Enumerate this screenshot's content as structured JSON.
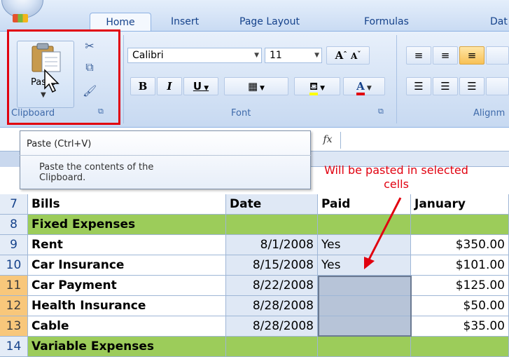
{
  "ribbon": {
    "tabs": [
      "Home",
      "Insert",
      "Page Layout",
      "Formulas",
      "Dat"
    ],
    "clipboard": {
      "paste_label": "Paste",
      "group_label": "Clipboard"
    },
    "font": {
      "name": "Calibri",
      "size": "11",
      "grow_label": "A",
      "shrink_label": "A",
      "bold": "B",
      "italic": "I",
      "underline": "U",
      "color_letter": "A",
      "group_label": "Font"
    },
    "alignment": {
      "group_label": "Alignm"
    }
  },
  "formula_bar": {
    "fx_label": "fx"
  },
  "tooltip": {
    "title": "Paste (Ctrl+V)",
    "body": "Paste the contents of the\nClipboard."
  },
  "annotation": {
    "text": "Will be pasted in selected\ncells"
  },
  "sheet": {
    "rows": [
      {
        "num": "7",
        "bills": "Bills",
        "date": "Date",
        "paid": "Paid",
        "january": "January"
      },
      {
        "num": "8",
        "bills": "Fixed Expenses",
        "date": "",
        "paid": "",
        "january": ""
      },
      {
        "num": "9",
        "bills": "Rent",
        "date": "8/1/2008",
        "paid": "Yes",
        "january": "$350.00"
      },
      {
        "num": "10",
        "bills": "Car Insurance",
        "date": "8/15/2008",
        "paid": "Yes",
        "january": "$101.00"
      },
      {
        "num": "11",
        "bills": "Car Payment",
        "date": "8/22/2008",
        "paid": "",
        "january": "$125.00"
      },
      {
        "num": "12",
        "bills": "Health Insurance",
        "date": "8/28/2008",
        "paid": "",
        "january": "$50.00"
      },
      {
        "num": "13",
        "bills": "Cable",
        "date": "8/28/2008",
        "paid": "",
        "january": "$35.00"
      },
      {
        "num": "14",
        "bills": "Variable Expenses",
        "date": "",
        "paid": "",
        "january": ""
      }
    ]
  },
  "colors": {
    "highlight_red": "#e1000f",
    "group_green": "#9ccc5a",
    "selected_row_header": "#f8c77b",
    "selected_cells": "#b7c4d8"
  }
}
